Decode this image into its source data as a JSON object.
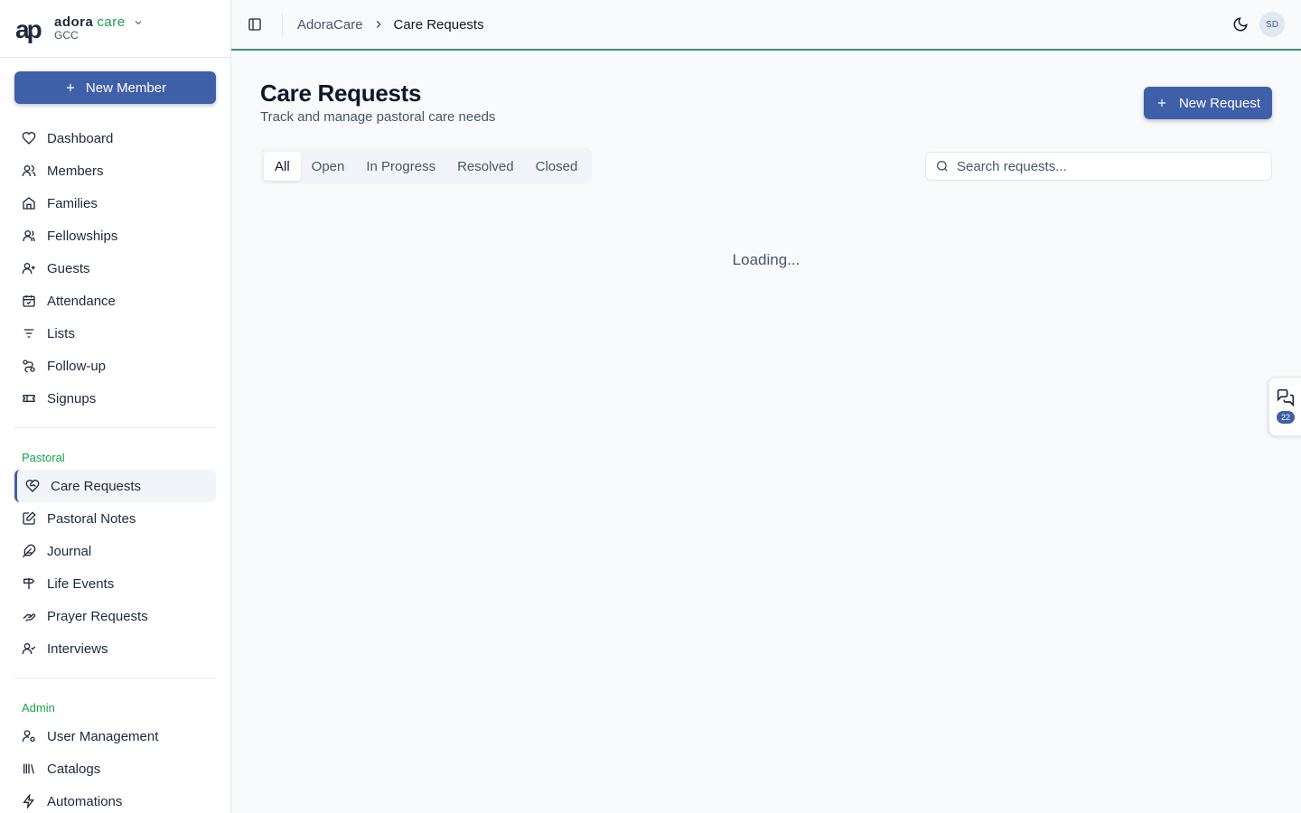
{
  "brand": {
    "name_bold": "adora",
    "name_accent": "care",
    "org": "GCC"
  },
  "sidebar": {
    "new_member_label": "New Member",
    "main_items": [
      {
        "label": "Dashboard",
        "icon": "heart-icon"
      },
      {
        "label": "Members",
        "icon": "users-icon"
      },
      {
        "label": "Families",
        "icon": "home-icon"
      },
      {
        "label": "Fellowships",
        "icon": "group-icon"
      },
      {
        "label": "Guests",
        "icon": "user-plus-icon"
      },
      {
        "label": "Attendance",
        "icon": "calendar-check-icon"
      },
      {
        "label": "Lists",
        "icon": "filter-lines-icon"
      },
      {
        "label": "Follow-up",
        "icon": "route-icon"
      },
      {
        "label": "Signups",
        "icon": "ticket-icon"
      }
    ],
    "pastoral_label": "Pastoral",
    "pastoral_items": [
      {
        "label": "Care Requests",
        "icon": "heart-handshake-icon",
        "active": true
      },
      {
        "label": "Pastoral Notes",
        "icon": "note-edit-icon"
      },
      {
        "label": "Journal",
        "icon": "feather-icon"
      },
      {
        "label": "Life Events",
        "icon": "signpost-icon"
      },
      {
        "label": "Prayer Requests",
        "icon": "hands-icon"
      },
      {
        "label": "Interviews",
        "icon": "user-check-icon"
      }
    ],
    "admin_label": "Admin",
    "admin_items": [
      {
        "label": "User Management",
        "icon": "user-cog-icon"
      },
      {
        "label": "Catalogs",
        "icon": "library-icon"
      },
      {
        "label": "Automations",
        "icon": "zap-icon"
      }
    ]
  },
  "topbar": {
    "breadcrumb_root": "AdoraCare",
    "breadcrumb_current": "Care Requests",
    "avatar_initials": "SD"
  },
  "main": {
    "title": "Care Requests",
    "subtitle": "Track and manage pastoral care needs",
    "new_request_label": "New Request",
    "tabs": [
      {
        "label": "All",
        "active": true
      },
      {
        "label": "Open"
      },
      {
        "label": "In Progress"
      },
      {
        "label": "Resolved"
      },
      {
        "label": "Closed"
      }
    ],
    "search_placeholder": "Search requests...",
    "loading_text": "Loading..."
  },
  "chat": {
    "badge_count": "22"
  },
  "colors": {
    "primary": "#3f5fa8",
    "accent_green": "#16a34a",
    "topbar_border": "#3f8f6e"
  }
}
